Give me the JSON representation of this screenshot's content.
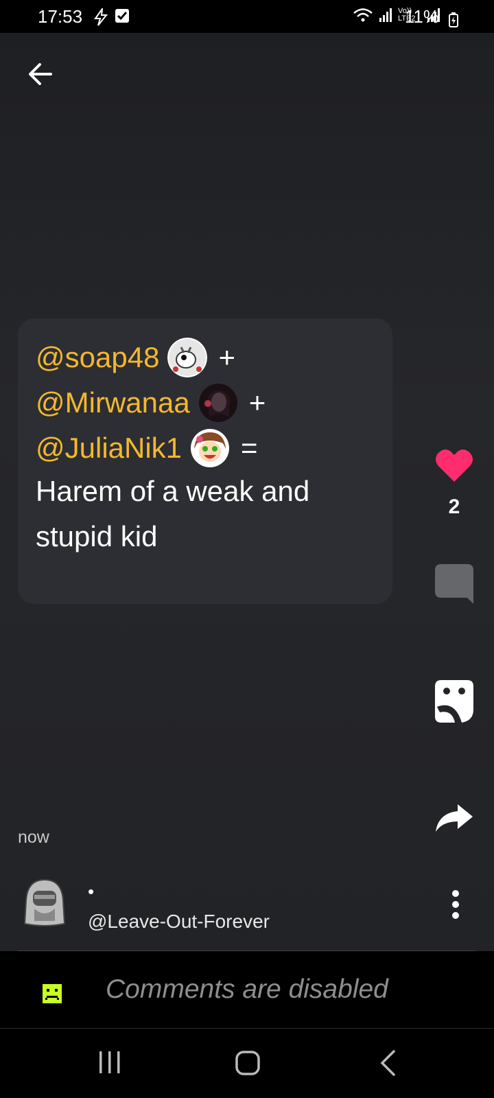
{
  "status_bar": {
    "time": "17:53",
    "battery": "11%",
    "network_label": "Vo)) LTE2"
  },
  "post": {
    "lines": [
      {
        "mention": "@soap48",
        "operator": "+"
      },
      {
        "mention": "@Mirwanaa",
        "operator": "+"
      },
      {
        "mention": "@JuliaNik1",
        "operator": "="
      }
    ],
    "text_line1": "Harem of a weak and",
    "text_line2": "stupid kid"
  },
  "actions": {
    "like_count": "2"
  },
  "meta": {
    "timestamp": "now",
    "author_name": "•",
    "author_handle": "@Leave-Out-Forever"
  },
  "comments": {
    "disabled_text": "Comments are disabled"
  },
  "colors": {
    "mention": "#f5b82d",
    "like": "#ff2d6f",
    "comment_icon": "#c8ff24",
    "background": "#242529"
  }
}
